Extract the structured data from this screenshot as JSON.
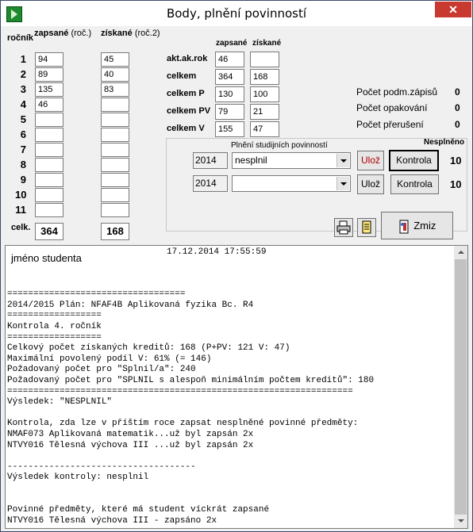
{
  "window": {
    "title": "Body, plnění povinností",
    "close": "✕"
  },
  "left": {
    "rocnik": "ročník",
    "zapsane": "zapsané",
    "zapsane_suffix": "(roč.)",
    "ziskane": "získané",
    "ziskane_suffix": "(roč.2)",
    "rows": [
      {
        "n": "1",
        "zapsane": "94",
        "ziskane": "45"
      },
      {
        "n": "2",
        "zapsane": "89",
        "ziskane": "40"
      },
      {
        "n": "3",
        "zapsane": "135",
        "ziskane": "83"
      },
      {
        "n": "4",
        "zapsane": "46",
        "ziskane": ""
      },
      {
        "n": "5",
        "zapsane": "",
        "ziskane": ""
      },
      {
        "n": "6",
        "zapsane": "",
        "ziskane": ""
      },
      {
        "n": "7",
        "zapsane": "",
        "ziskane": ""
      },
      {
        "n": "8",
        "zapsane": "",
        "ziskane": ""
      },
      {
        "n": "9",
        "zapsane": "",
        "ziskane": ""
      },
      {
        "n": "10",
        "zapsane": "",
        "ziskane": ""
      },
      {
        "n": "11",
        "zapsane": "",
        "ziskane": ""
      }
    ],
    "celk_label": "celk.",
    "celk_zapsane": "364",
    "celk_ziskane": "168"
  },
  "mid": {
    "header_zapsane": "zapsané",
    "header_ziskane": "získané",
    "rows": [
      {
        "label": "akt.ak.rok",
        "zapsane": "46",
        "ziskane": ""
      },
      {
        "label": "celkem",
        "zapsane": "364",
        "ziskane": "168"
      },
      {
        "label": "celkem P",
        "zapsane": "130",
        "ziskane": "100"
      },
      {
        "label": "celkem PV",
        "zapsane": "79",
        "ziskane": "21"
      },
      {
        "label": "celkem V",
        "zapsane": "155",
        "ziskane": "47"
      }
    ]
  },
  "right": {
    "stats": [
      {
        "label": "Počet podm.zápisů",
        "value": "0"
      },
      {
        "label": "Počet opakování",
        "value": "0"
      },
      {
        "label": "Počet přerušení",
        "value": "0"
      }
    ]
  },
  "plneni": {
    "title": "Plnění studijních povinností",
    "nesplneno_header": "Nesplněno",
    "rows": [
      {
        "year": "2014",
        "select": "nesplnil",
        "save": "Ulož",
        "check": "Kontrola",
        "nesplneno": "10"
      },
      {
        "year": "2014",
        "select": "",
        "save": "Ulož",
        "check": "Kontrola",
        "nesplneno": "10"
      }
    ]
  },
  "toolbar": {
    "zmiz": "Zmiz"
  },
  "report": {
    "student": "jméno studenta",
    "datetime": "17.12.2014 17:55:59",
    "lines": [
      "",
      "",
      "==================================",
      "2014/2015 Plán: NFAF4B Aplikovaná fyzika Bc. R4",
      "==================",
      "Kontrola 4. ročník",
      "==================",
      "Celkový počet získaných kreditů: 168 (P+PV: 121 V: 47)",
      "Maximální povolený podíl V: 61% (= 146)",
      "Požadovaný počet pro \"Splnil/a\": 240",
      "Požadovaný počet pro \"SPLNIL s alespoň minimálním počtem kreditů\": 180",
      "==================================================================",
      "Výsledek: \"NESPLNIL\"",
      "",
      "Kontrola, zda lze v příštím roce zapsat nesplněné povinné předměty:",
      "NMAF073 Aplikovaná matematik...už byl zapsán 2x",
      "NTVY016 Tělesná výchova III ...už byl zapsán 2x",
      "",
      "------------------------------------",
      "Výsledek kontroly: nesplnil",
      "",
      "",
      "Povinné předměty, které má student víckrát zapsané",
      "NTVY016 Tělesná výchova III - zapsáno 2x"
    ]
  }
}
